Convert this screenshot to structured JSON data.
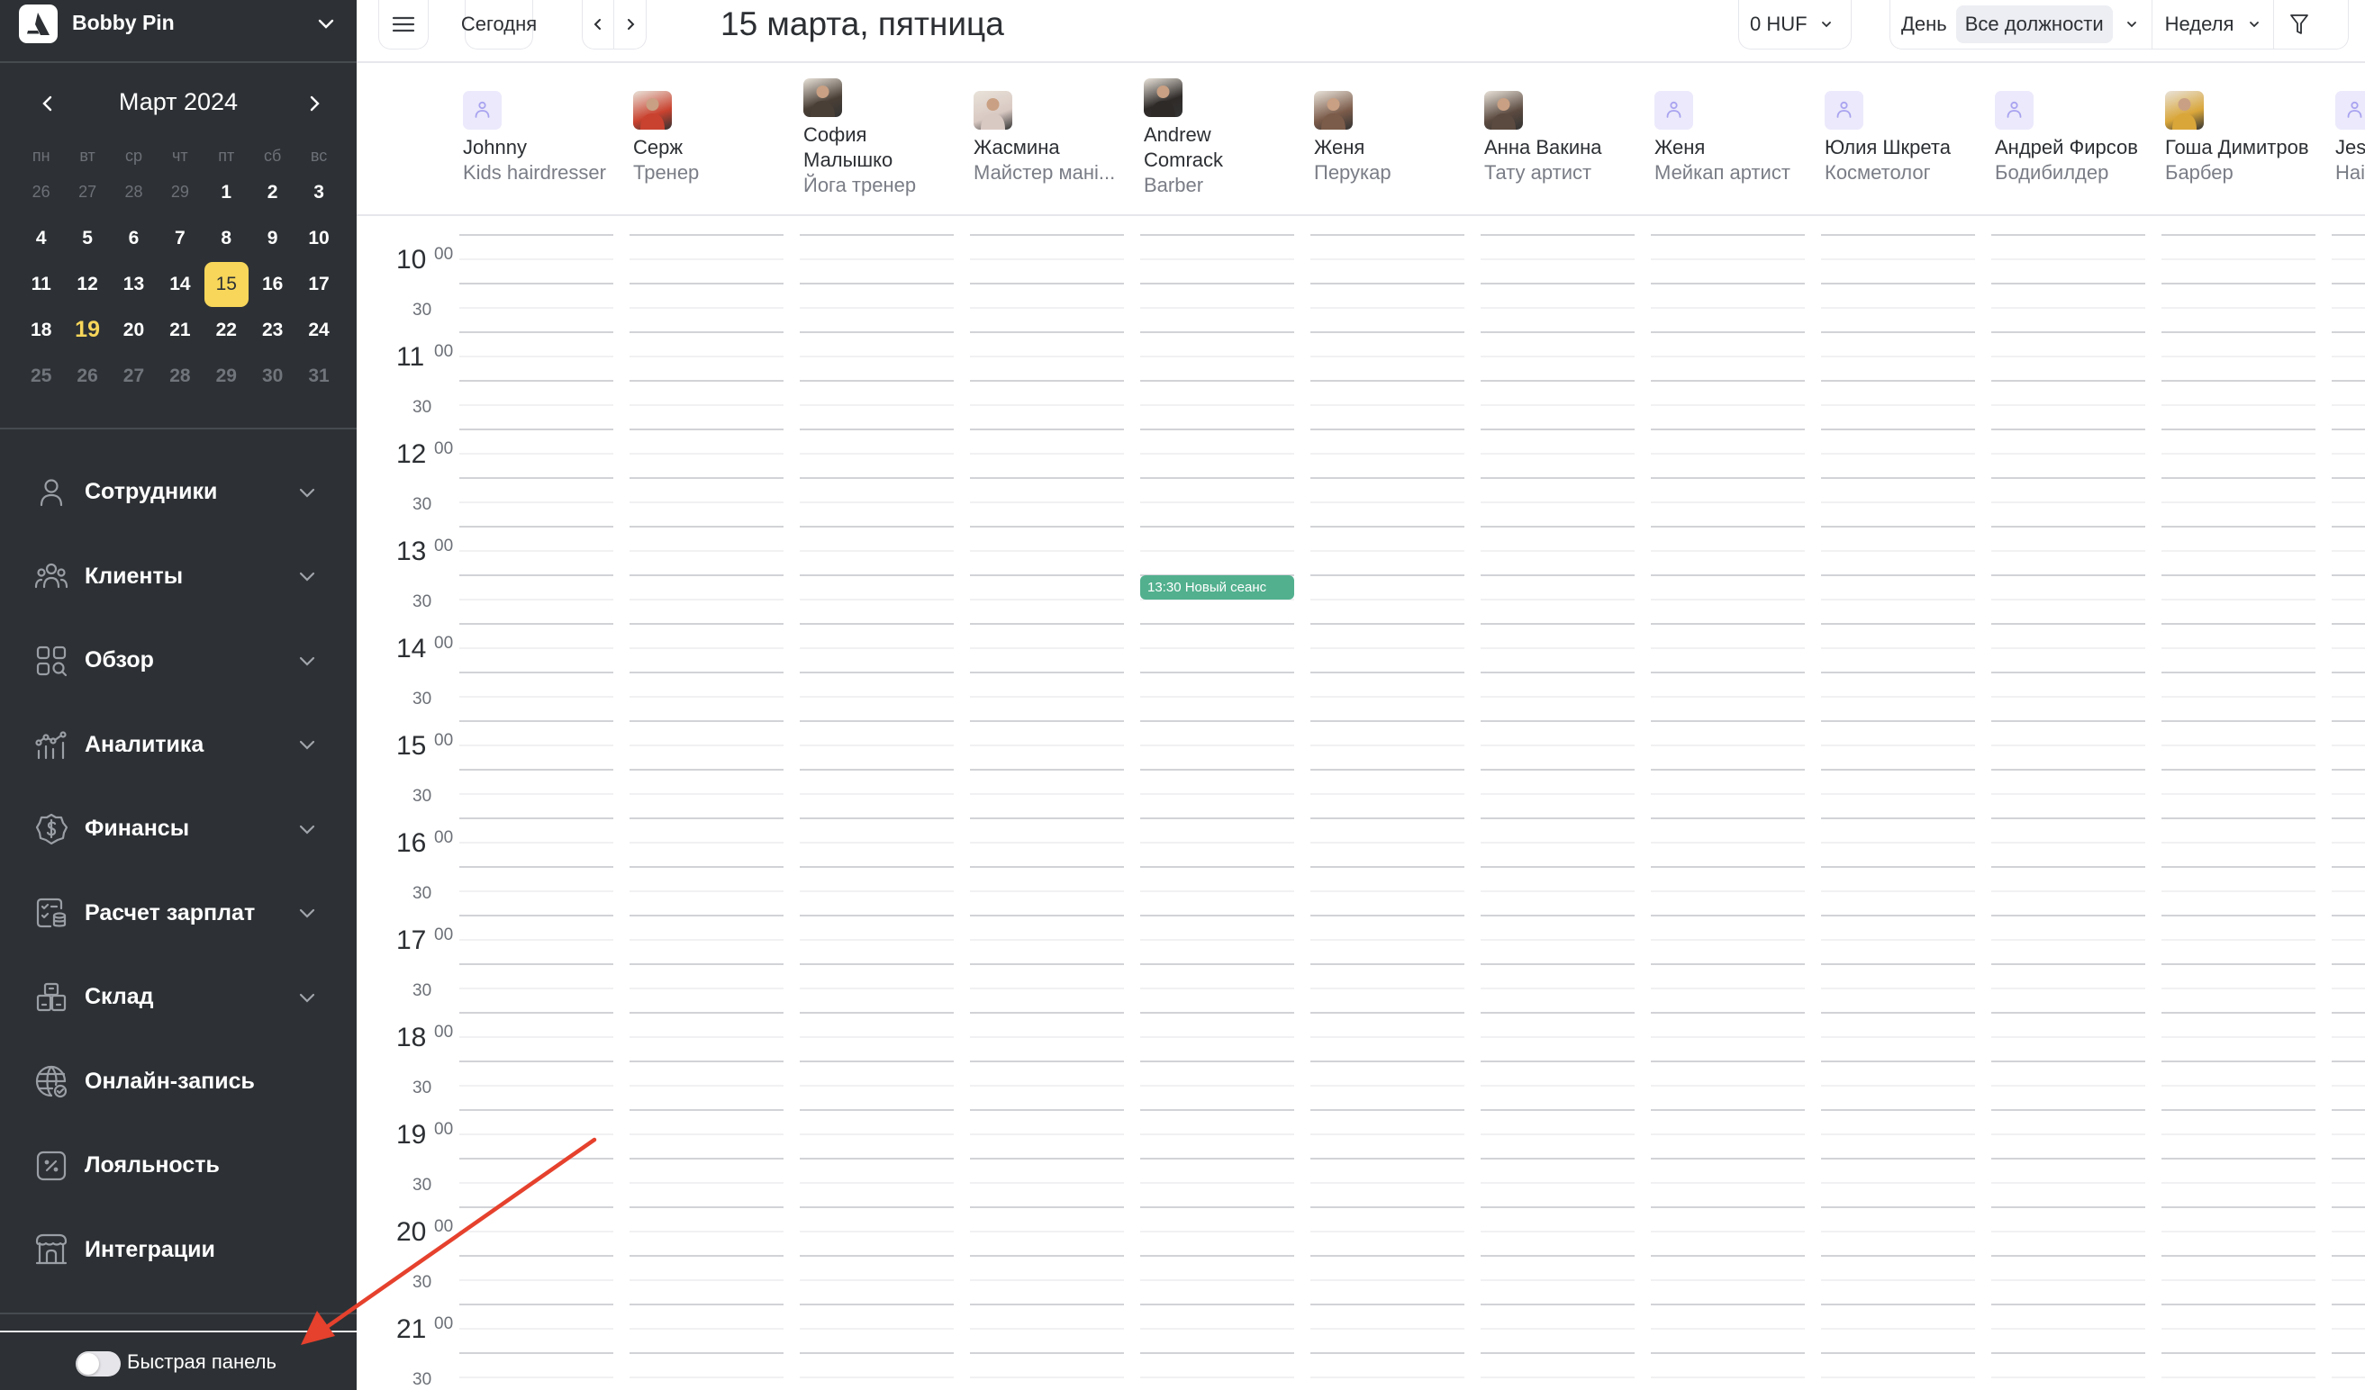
{
  "sidebar": {
    "company_name": "Bobby Pin",
    "calendar": {
      "month_title": "Март 2024",
      "weekdays": [
        "пн",
        "вт",
        "ср",
        "чт",
        "пт",
        "сб",
        "вс"
      ],
      "weeks": [
        [
          {
            "d": "26",
            "m": true
          },
          {
            "d": "27",
            "m": true
          },
          {
            "d": "28",
            "m": true
          },
          {
            "d": "29",
            "m": true
          },
          {
            "d": "1"
          },
          {
            "d": "2"
          },
          {
            "d": "3"
          }
        ],
        [
          {
            "d": "4"
          },
          {
            "d": "5"
          },
          {
            "d": "6"
          },
          {
            "d": "7"
          },
          {
            "d": "8"
          },
          {
            "d": "9"
          },
          {
            "d": "10"
          }
        ],
        [
          {
            "d": "11"
          },
          {
            "d": "12"
          },
          {
            "d": "13"
          },
          {
            "d": "14"
          },
          {
            "d": "15",
            "selected": true
          },
          {
            "d": "16"
          },
          {
            "d": "17"
          }
        ],
        [
          {
            "d": "18"
          },
          {
            "d": "19",
            "today": true
          },
          {
            "d": "20"
          },
          {
            "d": "21"
          },
          {
            "d": "22"
          },
          {
            "d": "23"
          },
          {
            "d": "24"
          }
        ],
        [
          {
            "d": "25",
            "m": true,
            "b": true
          },
          {
            "d": "26",
            "m": true,
            "b": true
          },
          {
            "d": "27",
            "m": true,
            "b": true
          },
          {
            "d": "28",
            "m": true,
            "b": true
          },
          {
            "d": "29",
            "m": true,
            "b": true
          },
          {
            "d": "30",
            "m": true,
            "b": true
          },
          {
            "d": "31",
            "m": true,
            "b": true
          }
        ]
      ]
    },
    "nav": [
      {
        "label": "Сотрудники",
        "icon": "user-icon",
        "chevron": true
      },
      {
        "label": "Клиенты",
        "icon": "users-group-icon",
        "chevron": true
      },
      {
        "label": "Обзор",
        "icon": "grid-search-icon",
        "chevron": true
      },
      {
        "label": "Аналитика",
        "icon": "analytics-chart-icon",
        "chevron": true
      },
      {
        "label": "Финансы",
        "icon": "dollar-badge-icon",
        "chevron": true
      },
      {
        "label": "Расчет зарплат",
        "icon": "payroll-icon",
        "chevron": true
      },
      {
        "label": "Склад",
        "icon": "boxes-icon",
        "chevron": true
      },
      {
        "label": "Онлайн-запись",
        "icon": "globe-check-icon",
        "chevron": false
      },
      {
        "label": "Лояльность",
        "icon": "percent-tag-icon",
        "chevron": false
      },
      {
        "label": "Интеграции",
        "icon": "store-icon",
        "chevron": false
      }
    ],
    "quick_panel_label": "Быстрая панель",
    "quick_panel_enabled": false
  },
  "topbar": {
    "today_label": "Сегодня",
    "date_title": "15 марта, пятница",
    "balance": "0 HUF",
    "view_day": "День",
    "positions_filter": "Все должности",
    "period": "Неделя"
  },
  "staff": [
    {
      "name": "Johnny",
      "role": "Kids hairdresser",
      "avatar": "placeholder"
    },
    {
      "name": "Серж",
      "role": "Тренер",
      "avatar": "photo",
      "color": "#c9422f"
    },
    {
      "name": "София Малышко",
      "name_lines": [
        "София",
        "Малышко"
      ],
      "role": "Йога тренер",
      "avatar": "photo",
      "color": "#4a3f36"
    },
    {
      "name": "Жасмина",
      "role": "Майстер мані...",
      "avatar": "photo",
      "color": "#d9c9c3"
    },
    {
      "name": "Andrew Comrack",
      "name_lines": [
        "Andrew",
        "Comrack"
      ],
      "role": "Barber",
      "avatar": "photo",
      "color": "#2e2a28"
    },
    {
      "name": "Женя",
      "role": "Перукар",
      "avatar": "photo",
      "color": "#7b5b4a"
    },
    {
      "name": "Анна Вакина",
      "role": "Тату артист",
      "avatar": "photo",
      "color": "#5b4a40"
    },
    {
      "name": "Женя",
      "role": "Мейкап артист",
      "avatar": "placeholder"
    },
    {
      "name": "Юлия Шкрета",
      "role": "Косметолог",
      "avatar": "placeholder"
    },
    {
      "name": "Андрей Фирсов",
      "role": "Бодибилдер",
      "avatar": "placeholder"
    },
    {
      "name": "Гоша Димитров",
      "role": "Барбер",
      "avatar": "photo",
      "color": "#d9a63a"
    },
    {
      "name": "Jes",
      "role": "Hai",
      "avatar": "placeholder"
    }
  ],
  "schedule": {
    "hours": [
      "10",
      "11",
      "12",
      "13",
      "14",
      "15",
      "16",
      "17",
      "18",
      "19",
      "20",
      "21"
    ],
    "minute_labels": {
      "full": "00",
      "half": "30"
    },
    "events": [
      {
        "staff_index": 4,
        "start": "13:30",
        "label": "13:30 Новый сеанс",
        "color": "#52b08e"
      }
    ]
  },
  "colors": {
    "sidebar_bg": "#2d3135",
    "accent_yellow": "#f7d65a",
    "event_green": "#52b08e",
    "annotation_red": "#e5412d"
  }
}
